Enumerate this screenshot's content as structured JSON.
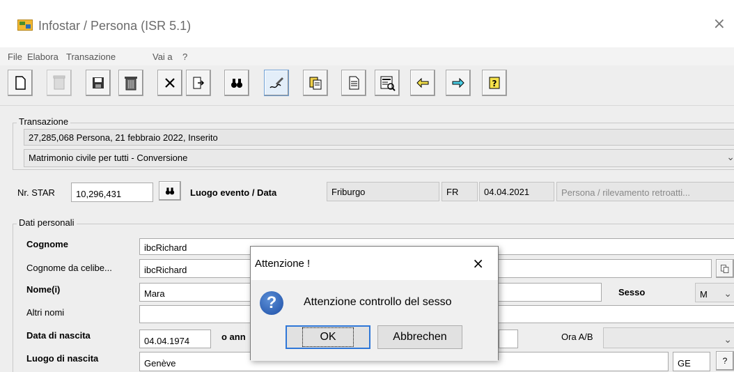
{
  "window": {
    "title": "Infostar / Persona (ISR 5.1)",
    "close": "×"
  },
  "menu": [
    "File",
    "Elabora",
    "Transazione",
    "Vai a",
    "?"
  ],
  "toolbar": {
    "buttons": [
      "new-document-icon",
      "delete-disabled-icon",
      "save-icon",
      "trash-icon",
      "cancel-icon",
      "open-record-icon",
      "search-binoculars-icon",
      "edit-sign-icon",
      "copy-clipboard-icon",
      "document-icon",
      "form-view-icon",
      "back-arrow-icon",
      "forward-arrow-icon",
      "help-icon"
    ]
  },
  "transazione": {
    "group_title": "Transazione",
    "info": "27,285,068  Persona, 21 febbraio 2022, Inserito",
    "selected": "Matrimonio civile per tutti - Conversione"
  },
  "star": {
    "label": "Nr. STAR",
    "value": "10,296,431",
    "luogo_label": "Luogo evento / Data",
    "luogo_value": "Friburgo",
    "canton": "FR",
    "date": "04.04.2021",
    "type": "Persona / rilevamento retroatti..."
  },
  "dati": {
    "group_title": "Dati personali",
    "cognome_label": "Cognome",
    "cognome_value": "ibcRichard",
    "cognome_celibe_label": "Cognome da celibe...",
    "cognome_celibe_value": "ibcRichard",
    "nome_label": "Nome(i)",
    "nome_value": "Mara",
    "sesso_label": "Sesso",
    "sesso_value": "M",
    "altri_nomi_label": "Altri nomi",
    "altri_nomi_value": "",
    "data_nascita_label": "Data di nascita",
    "data_nascita_value": "04.04.1974",
    "o_anno_label": "o ann",
    "ora_label": "Ora A/B",
    "luogo_nascita_label": "Luogo di nascita",
    "luogo_nascita_value": "Genève",
    "luogo_canton": "GE",
    "help_q": "?"
  },
  "dialog": {
    "title": "Attenzione !",
    "close": "×",
    "message": "Attenzione controllo del sesso",
    "ok": "OK",
    "cancel": "Abbrechen",
    "icon": "question-icon"
  }
}
